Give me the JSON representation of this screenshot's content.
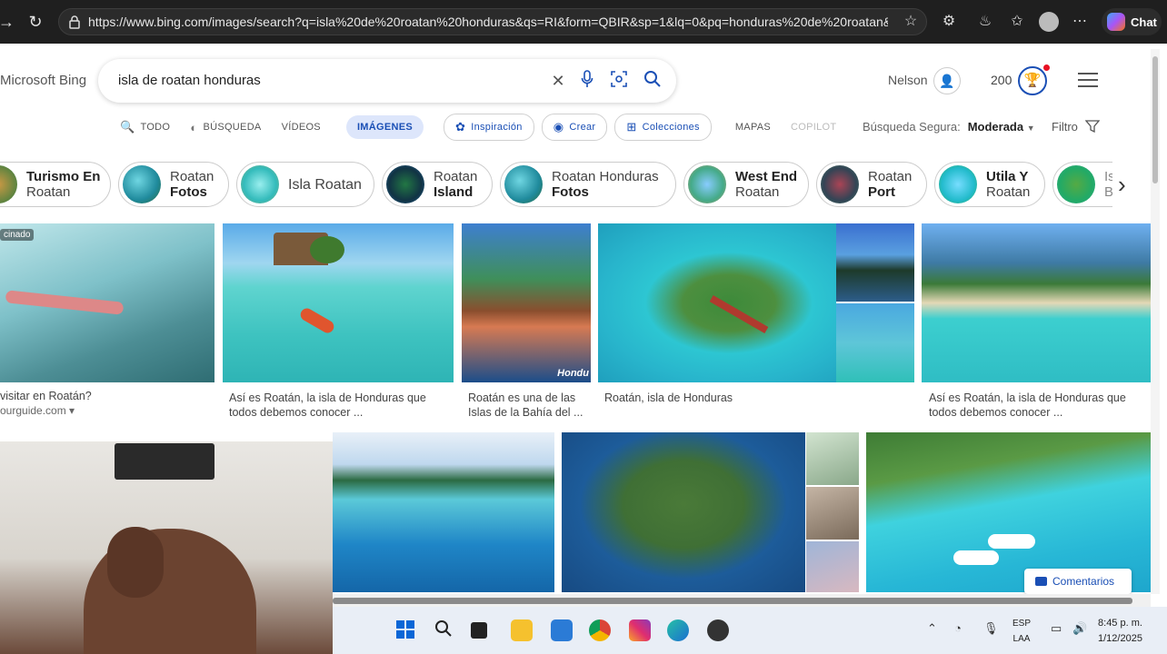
{
  "browser": {
    "url": "https://www.bing.com/images/search?q=isla%20de%20roatan%20honduras&qs=RI&form=QBIR&sp=1&lq=0&pq=honduras%20de%20roatan&...",
    "chat_label": "Chat"
  },
  "header": {
    "brand": "Microsoft Bing",
    "query": "isla de roatan honduras",
    "user_name": "Nelson",
    "points": "200"
  },
  "tabs": [
    {
      "label": "TODO"
    },
    {
      "label": "BÚSQUEDA"
    },
    {
      "label": "VÍDEOS"
    },
    {
      "label": "IMÁGENES"
    },
    {
      "label": "Inspiración"
    },
    {
      "label": "Crear"
    },
    {
      "label": "Colecciones"
    },
    {
      "label": "MAPAS"
    },
    {
      "label": "COPILOT"
    }
  ],
  "safe_search": {
    "label": "Búsqueda Segura:",
    "value": "Moderada"
  },
  "filter_label": "Filtro",
  "chips": [
    {
      "line1": "Turismo En",
      "line2": "Roatan",
      "bold": "first"
    },
    {
      "line1": "Roatan",
      "line2": "Fotos",
      "bold": "second"
    },
    {
      "line1": "Isla Roatan",
      "line2": "",
      "bold": "none"
    },
    {
      "line1": "Roatan",
      "line2": "Island",
      "bold": "second"
    },
    {
      "line1": "Roatan Honduras",
      "line2": "Fotos",
      "bold": "second"
    },
    {
      "line1": "West End",
      "line2": "Roatan",
      "bold": "first"
    },
    {
      "line1": "Roatan",
      "line2": "Port",
      "bold": "second"
    },
    {
      "line1": "Utila Y",
      "line2": "Roatan",
      "bold": "first"
    },
    {
      "line1": "Is",
      "line2": "Ba",
      "bold": "none"
    }
  ],
  "results": {
    "badge": "cinado",
    "cap1_line1": "visitar en Roatán?",
    "cap1_source": "ourguide.com ▾",
    "cap2": "Así es Roatán, la isla de Honduras que todos debemos conocer ...",
    "cap3": "Roatán es una de las Islas de la Bahía del ...",
    "cap4": "Roatán, isla de Honduras",
    "cap5": "Así es Roatán, la isla de Honduras que todos debemos conocer ...",
    "watermark": "Hondu"
  },
  "feedback_label": "Comentarios",
  "taskbar": {
    "lang1": "ESP",
    "lang2": "LAA",
    "time": "8:45 p. m.",
    "date": "1/12/2025"
  },
  "colors": {
    "accent": "#1a4fb5",
    "browser_bg": "#1f1f1f",
    "taskbar_bg": "#e9eef6"
  }
}
